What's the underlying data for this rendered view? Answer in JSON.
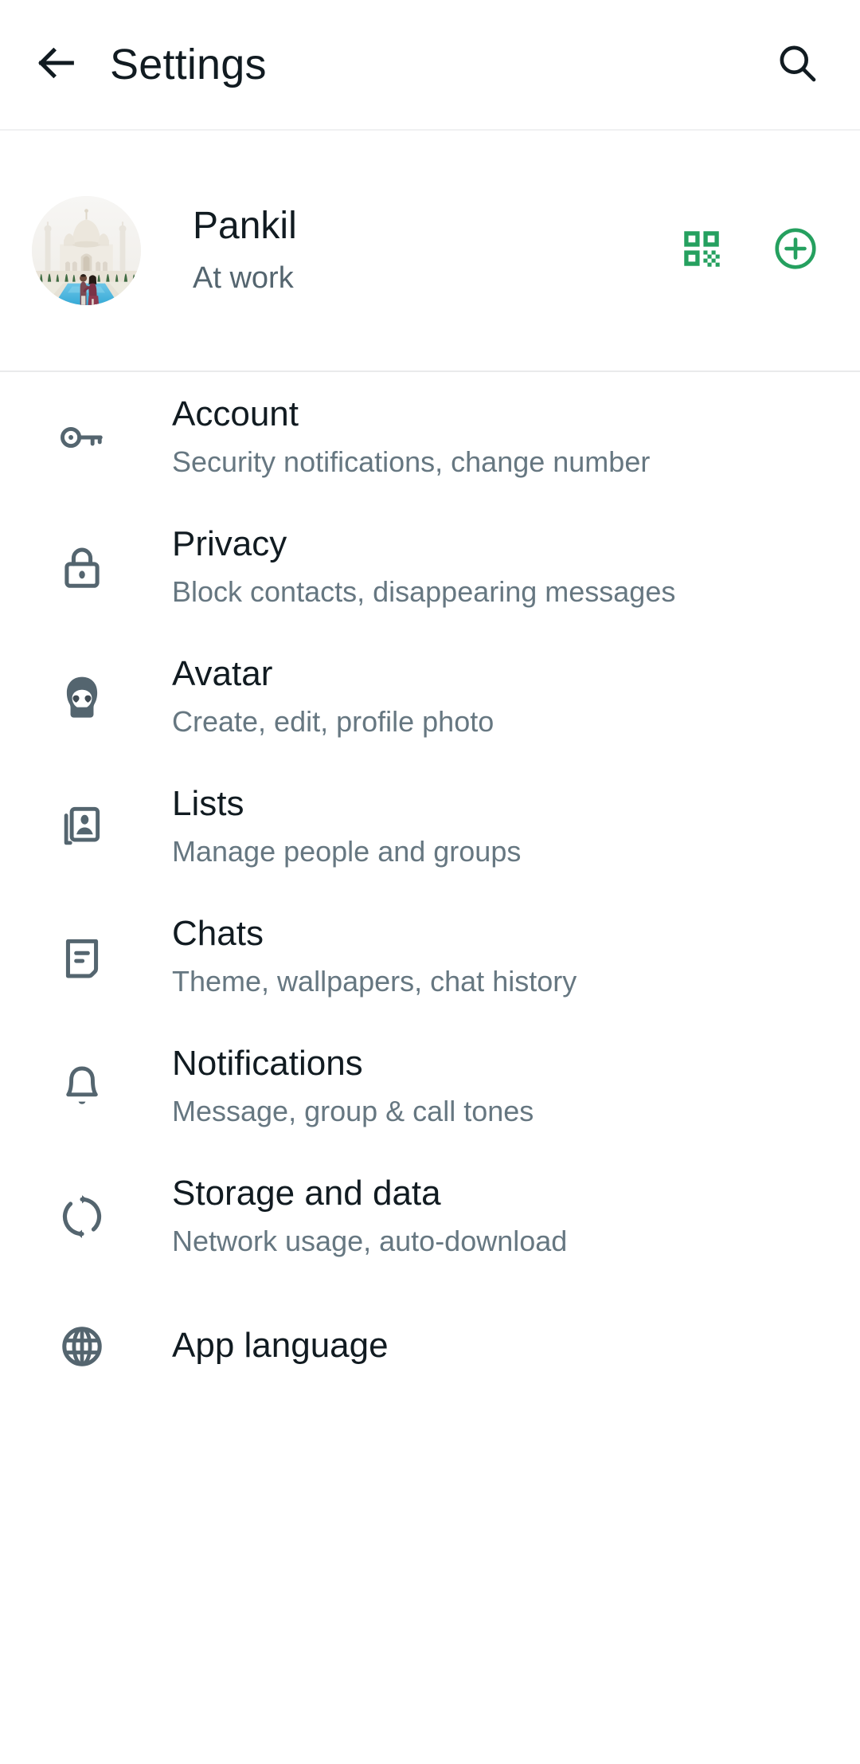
{
  "appbar": {
    "back_icon": "arrow-left-icon",
    "title": "Settings",
    "search_icon": "search-icon"
  },
  "profile": {
    "avatar_icon": "profile-photo-taj-mahal-couple",
    "name": "Pankil",
    "status": "At work",
    "actions": [
      {
        "icon": "qr-code-icon",
        "name": "qr-code-button"
      },
      {
        "icon": "plus-circle-icon",
        "name": "add-account-button"
      }
    ]
  },
  "colors": {
    "accent_green": "#25a05f",
    "title_text": "#111b21",
    "subtitle_text": "#667781",
    "icon_gray": "#54656f",
    "divider": "#e9eaeb",
    "background": "#ffffff"
  },
  "settings": [
    {
      "icon": "key-icon",
      "title": "Account",
      "subtitle": "Security notifications, change number"
    },
    {
      "icon": "lock-icon",
      "title": "Privacy",
      "subtitle": "Block contacts, disappearing messages"
    },
    {
      "icon": "avatar-face-icon",
      "title": "Avatar",
      "subtitle": "Create, edit, profile photo"
    },
    {
      "icon": "contact-card-icon",
      "title": "Lists",
      "subtitle": "Manage people and groups"
    },
    {
      "icon": "chat-bubble-icon",
      "title": "Chats",
      "subtitle": "Theme, wallpapers, chat history"
    },
    {
      "icon": "bell-icon",
      "title": "Notifications",
      "subtitle": "Message, group & call tones"
    },
    {
      "icon": "storage-arrows-icon",
      "title": "Storage and data",
      "subtitle": "Network usage, auto-download"
    },
    {
      "icon": "globe-icon",
      "title": "App language",
      "subtitle": ""
    }
  ]
}
